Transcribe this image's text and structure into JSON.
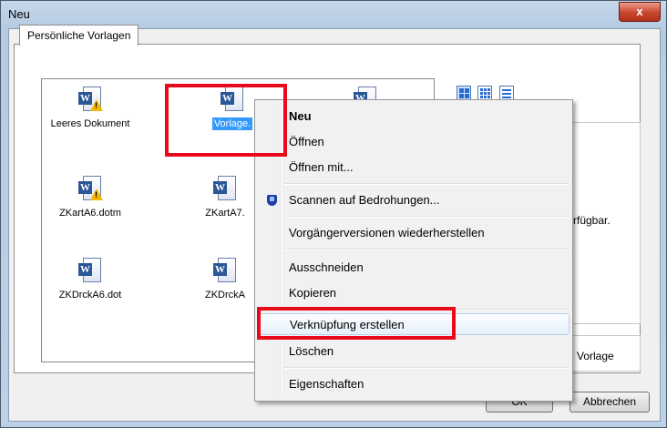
{
  "window": {
    "title": "Neu",
    "close_label": "x"
  },
  "tab": {
    "label": "Persönliche Vorlagen"
  },
  "files": [
    {
      "label": "Leeres Dokument",
      "icon": "word-macro-template-icon"
    },
    {
      "label": "Vorlage.",
      "icon": "word-template-icon",
      "selected": true
    },
    {
      "label": "",
      "icon": "word-template-icon"
    },
    {
      "label": "ZKartA6.dotm",
      "icon": "word-macro-template-icon"
    },
    {
      "label": "ZKartA7.",
      "icon": "word-template-icon"
    },
    {
      "label": "ZKDrckA6.dot",
      "icon": "word-template-icon"
    },
    {
      "label": "ZKDrckA",
      "icon": "word-template-icon"
    }
  ],
  "preview": {
    "text": "rfügbar."
  },
  "create_new": {
    "text": "Vorlage"
  },
  "buttons": {
    "ok": "OK",
    "cancel": "Abbrechen"
  },
  "context_menu": [
    {
      "label": "Neu",
      "bold": true
    },
    {
      "label": "Öffnen"
    },
    {
      "label": "Öffnen mit..."
    },
    {
      "label": "Scannen auf Bedrohungen...",
      "icon": "shield-icon"
    },
    {
      "label": "Vorgängerversionen wiederherstellen"
    },
    {
      "label": "Ausschneiden"
    },
    {
      "label": "Kopieren"
    },
    {
      "label": "Verknüpfung erstellen",
      "highlighted": true
    },
    {
      "label": "Löschen"
    },
    {
      "label": "Eigenschaften"
    }
  ],
  "colors": {
    "highlight_box": "#e8091a",
    "selection": "#3399ff"
  }
}
